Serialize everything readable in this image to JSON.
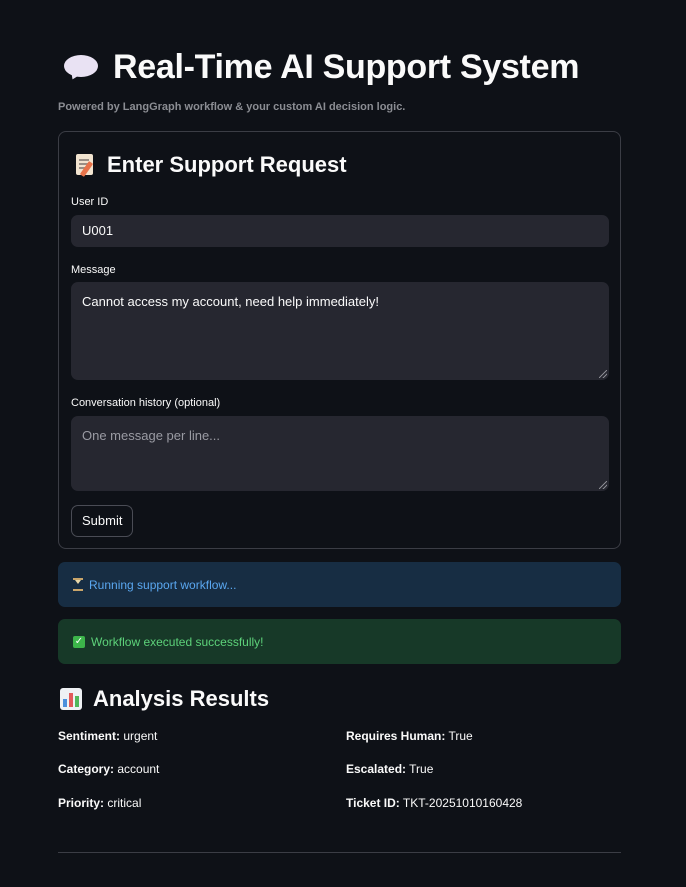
{
  "header": {
    "icon": "speech-bubble-icon",
    "title": "Real-Time AI Support System",
    "subtitle": "Powered by LangGraph workflow & your custom AI decision logic."
  },
  "form": {
    "icon": "memo-icon",
    "title": "Enter Support Request",
    "user_id": {
      "label": "User ID",
      "value": "U001"
    },
    "message": {
      "label": "Message",
      "value": "Cannot access my account, need help immediately!"
    },
    "history": {
      "label": "Conversation history (optional)",
      "value": "",
      "placeholder": "One message per line..."
    },
    "submit_label": "Submit"
  },
  "status": {
    "running": {
      "icon": "hourglass-icon",
      "text": "Running support workflow...",
      "color": "#5aa7f0"
    },
    "success": {
      "icon": "check-box-icon",
      "text": "Workflow executed successfully!",
      "color": "#5dd27a"
    }
  },
  "results": {
    "icon": "bar-chart-icon",
    "title": "Analysis Results",
    "left": [
      {
        "label": "Sentiment:",
        "value": "urgent"
      },
      {
        "label": "Category:",
        "value": "account"
      },
      {
        "label": "Priority:",
        "value": "critical"
      }
    ],
    "right": [
      {
        "label": "Requires Human:",
        "value": "True"
      },
      {
        "label": "Escalated:",
        "value": "True"
      },
      {
        "label": "Ticket ID:",
        "value": "TKT-20251010160428"
      }
    ]
  }
}
